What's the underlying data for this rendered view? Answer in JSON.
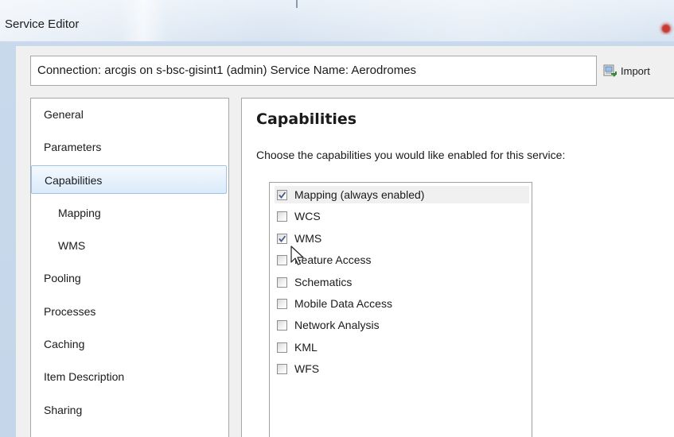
{
  "window": {
    "title": "Service Editor"
  },
  "connection": {
    "text": "Connection: arcgis on s-bsc-gisint1 (admin)   Service Name: Aerodromes",
    "import_label": "Import"
  },
  "nav": {
    "items": [
      {
        "label": "General",
        "sub": false,
        "selected": false
      },
      {
        "label": "Parameters",
        "sub": false,
        "selected": false
      },
      {
        "label": "Capabilities",
        "sub": false,
        "selected": true
      },
      {
        "label": "Mapping",
        "sub": true,
        "selected": false
      },
      {
        "label": "WMS",
        "sub": true,
        "selected": false
      },
      {
        "label": "Pooling",
        "sub": false,
        "selected": false
      },
      {
        "label": "Processes",
        "sub": false,
        "selected": false
      },
      {
        "label": "Caching",
        "sub": false,
        "selected": false
      },
      {
        "label": "Item Description",
        "sub": false,
        "selected": false
      },
      {
        "label": "Sharing",
        "sub": false,
        "selected": false
      }
    ]
  },
  "capabilities": {
    "heading": "Capabilities",
    "description": "Choose the capabilities you would like enabled for this service:",
    "options": [
      {
        "label": "Mapping (always enabled)",
        "checked": true
      },
      {
        "label": "WCS",
        "checked": false
      },
      {
        "label": "WMS",
        "checked": true
      },
      {
        "label": "Feature Access",
        "checked": false
      },
      {
        "label": "Schematics",
        "checked": false
      },
      {
        "label": "Mobile Data Access",
        "checked": false
      },
      {
        "label": "Network Analysis",
        "checked": false
      },
      {
        "label": "KML",
        "checked": false
      },
      {
        "label": "WFS",
        "checked": false
      }
    ]
  },
  "colors": {
    "selection_border": "#9ec4ea",
    "check_mark": "#4a5a8c"
  }
}
